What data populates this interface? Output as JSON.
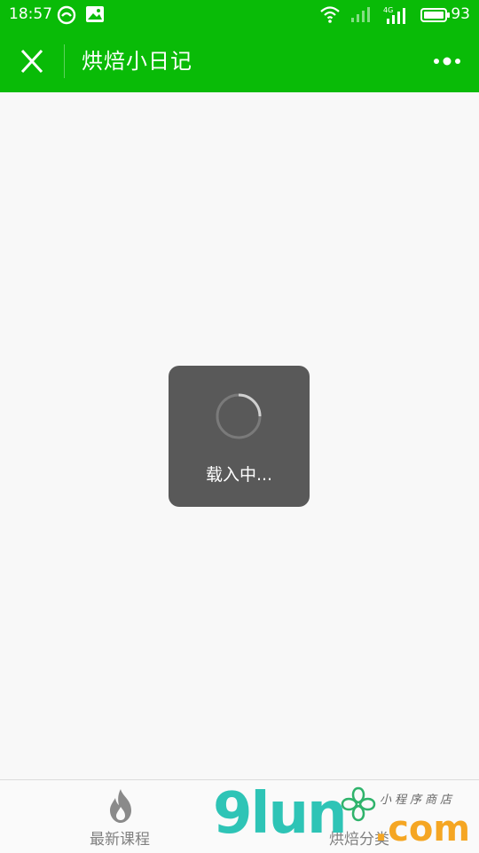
{
  "status_bar": {
    "time": "18:57",
    "battery_percent": "93",
    "icons": [
      "wechat-status-icon",
      "image-status-icon",
      "wifi-icon",
      "signal-icon",
      "signal-4g-icon",
      "battery-icon"
    ],
    "network_label": "4G"
  },
  "nav_bar": {
    "title": "烘焙小日记",
    "close_icon": "close-icon",
    "more_icon": "more-icon",
    "background": "#09bb07"
  },
  "loading": {
    "text": "载入中..."
  },
  "tab_bar": {
    "tabs": [
      {
        "label": "最新课程",
        "icon": "flame-icon"
      },
      {
        "label": "烘焙分类",
        "icon": "category-icon"
      }
    ]
  },
  "watermark": {
    "brand": "9lun",
    "suffix": ".com",
    "tagline": "小程序商店"
  }
}
